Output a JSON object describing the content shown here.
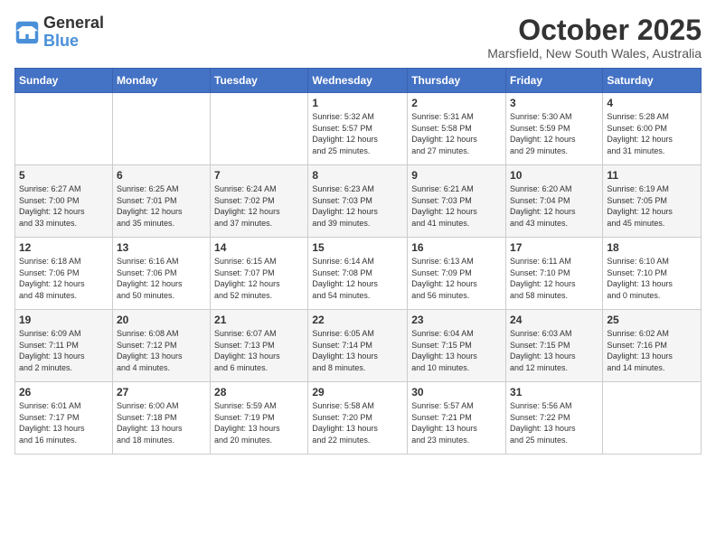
{
  "header": {
    "logo_line1": "General",
    "logo_line2": "Blue",
    "month": "October 2025",
    "location": "Marsfield, New South Wales, Australia"
  },
  "weekdays": [
    "Sunday",
    "Monday",
    "Tuesday",
    "Wednesday",
    "Thursday",
    "Friday",
    "Saturday"
  ],
  "weeks": [
    [
      {
        "day": "",
        "info": ""
      },
      {
        "day": "",
        "info": ""
      },
      {
        "day": "",
        "info": ""
      },
      {
        "day": "1",
        "info": "Sunrise: 5:32 AM\nSunset: 5:57 PM\nDaylight: 12 hours\nand 25 minutes."
      },
      {
        "day": "2",
        "info": "Sunrise: 5:31 AM\nSunset: 5:58 PM\nDaylight: 12 hours\nand 27 minutes."
      },
      {
        "day": "3",
        "info": "Sunrise: 5:30 AM\nSunset: 5:59 PM\nDaylight: 12 hours\nand 29 minutes."
      },
      {
        "day": "4",
        "info": "Sunrise: 5:28 AM\nSunset: 6:00 PM\nDaylight: 12 hours\nand 31 minutes."
      }
    ],
    [
      {
        "day": "5",
        "info": "Sunrise: 6:27 AM\nSunset: 7:00 PM\nDaylight: 12 hours\nand 33 minutes."
      },
      {
        "day": "6",
        "info": "Sunrise: 6:25 AM\nSunset: 7:01 PM\nDaylight: 12 hours\nand 35 minutes."
      },
      {
        "day": "7",
        "info": "Sunrise: 6:24 AM\nSunset: 7:02 PM\nDaylight: 12 hours\nand 37 minutes."
      },
      {
        "day": "8",
        "info": "Sunrise: 6:23 AM\nSunset: 7:03 PM\nDaylight: 12 hours\nand 39 minutes."
      },
      {
        "day": "9",
        "info": "Sunrise: 6:21 AM\nSunset: 7:03 PM\nDaylight: 12 hours\nand 41 minutes."
      },
      {
        "day": "10",
        "info": "Sunrise: 6:20 AM\nSunset: 7:04 PM\nDaylight: 12 hours\nand 43 minutes."
      },
      {
        "day": "11",
        "info": "Sunrise: 6:19 AM\nSunset: 7:05 PM\nDaylight: 12 hours\nand 45 minutes."
      }
    ],
    [
      {
        "day": "12",
        "info": "Sunrise: 6:18 AM\nSunset: 7:06 PM\nDaylight: 12 hours\nand 48 minutes."
      },
      {
        "day": "13",
        "info": "Sunrise: 6:16 AM\nSunset: 7:06 PM\nDaylight: 12 hours\nand 50 minutes."
      },
      {
        "day": "14",
        "info": "Sunrise: 6:15 AM\nSunset: 7:07 PM\nDaylight: 12 hours\nand 52 minutes."
      },
      {
        "day": "15",
        "info": "Sunrise: 6:14 AM\nSunset: 7:08 PM\nDaylight: 12 hours\nand 54 minutes."
      },
      {
        "day": "16",
        "info": "Sunrise: 6:13 AM\nSunset: 7:09 PM\nDaylight: 12 hours\nand 56 minutes."
      },
      {
        "day": "17",
        "info": "Sunrise: 6:11 AM\nSunset: 7:10 PM\nDaylight: 12 hours\nand 58 minutes."
      },
      {
        "day": "18",
        "info": "Sunrise: 6:10 AM\nSunset: 7:10 PM\nDaylight: 13 hours\nand 0 minutes."
      }
    ],
    [
      {
        "day": "19",
        "info": "Sunrise: 6:09 AM\nSunset: 7:11 PM\nDaylight: 13 hours\nand 2 minutes."
      },
      {
        "day": "20",
        "info": "Sunrise: 6:08 AM\nSunset: 7:12 PM\nDaylight: 13 hours\nand 4 minutes."
      },
      {
        "day": "21",
        "info": "Sunrise: 6:07 AM\nSunset: 7:13 PM\nDaylight: 13 hours\nand 6 minutes."
      },
      {
        "day": "22",
        "info": "Sunrise: 6:05 AM\nSunset: 7:14 PM\nDaylight: 13 hours\nand 8 minutes."
      },
      {
        "day": "23",
        "info": "Sunrise: 6:04 AM\nSunset: 7:15 PM\nDaylight: 13 hours\nand 10 minutes."
      },
      {
        "day": "24",
        "info": "Sunrise: 6:03 AM\nSunset: 7:15 PM\nDaylight: 13 hours\nand 12 minutes."
      },
      {
        "day": "25",
        "info": "Sunrise: 6:02 AM\nSunset: 7:16 PM\nDaylight: 13 hours\nand 14 minutes."
      }
    ],
    [
      {
        "day": "26",
        "info": "Sunrise: 6:01 AM\nSunset: 7:17 PM\nDaylight: 13 hours\nand 16 minutes."
      },
      {
        "day": "27",
        "info": "Sunrise: 6:00 AM\nSunset: 7:18 PM\nDaylight: 13 hours\nand 18 minutes."
      },
      {
        "day": "28",
        "info": "Sunrise: 5:59 AM\nSunset: 7:19 PM\nDaylight: 13 hours\nand 20 minutes."
      },
      {
        "day": "29",
        "info": "Sunrise: 5:58 AM\nSunset: 7:20 PM\nDaylight: 13 hours\nand 22 minutes."
      },
      {
        "day": "30",
        "info": "Sunrise: 5:57 AM\nSunset: 7:21 PM\nDaylight: 13 hours\nand 23 minutes."
      },
      {
        "day": "31",
        "info": "Sunrise: 5:56 AM\nSunset: 7:22 PM\nDaylight: 13 hours\nand 25 minutes."
      },
      {
        "day": "",
        "info": ""
      }
    ]
  ]
}
